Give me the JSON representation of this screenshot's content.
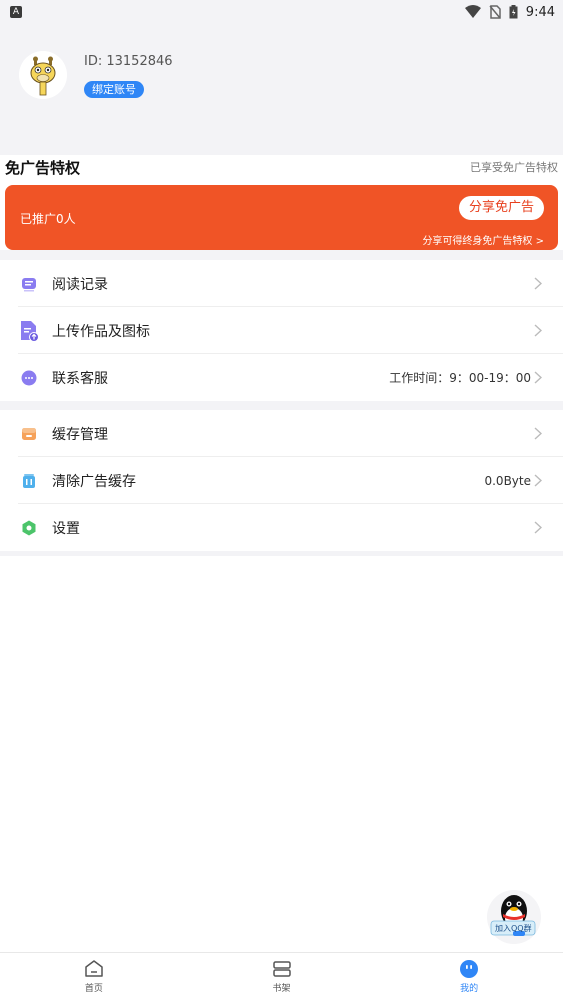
{
  "status_bar": {
    "time": "9:44",
    "left_icon_letter": "A"
  },
  "profile": {
    "user_id": "ID: 13152846",
    "bind_label": "绑定账号"
  },
  "privilege": {
    "title": "免广告特权",
    "status": "已享受免广告特权",
    "promoted_count": "已推广0人",
    "share_button": "分享免广告",
    "share_tip": "分享可得终身免广告特权 >"
  },
  "menu_group_1": [
    {
      "label": "阅读记录",
      "value": "",
      "icon": "reading-history-icon"
    },
    {
      "label": "上传作品及图标",
      "value": "",
      "icon": "upload-icon"
    },
    {
      "label": "联系客服",
      "value": "工作时间：9：00-19：00",
      "icon": "customer-service-icon"
    }
  ],
  "menu_group_2": [
    {
      "label": "缓存管理",
      "value": "",
      "icon": "cache-icon"
    },
    {
      "label": "清除广告缓存",
      "value": "0.0Byte",
      "icon": "clear-cache-icon"
    },
    {
      "label": "设置",
      "value": "",
      "icon": "settings-icon"
    }
  ],
  "qq_float": {
    "text": "加入QQ群"
  },
  "tabs": [
    {
      "label": "首页",
      "active": false
    },
    {
      "label": "书架",
      "active": false
    },
    {
      "label": "我的",
      "active": true
    }
  ],
  "colors": {
    "accent": "#2f86f6",
    "promo": "#f05426"
  }
}
